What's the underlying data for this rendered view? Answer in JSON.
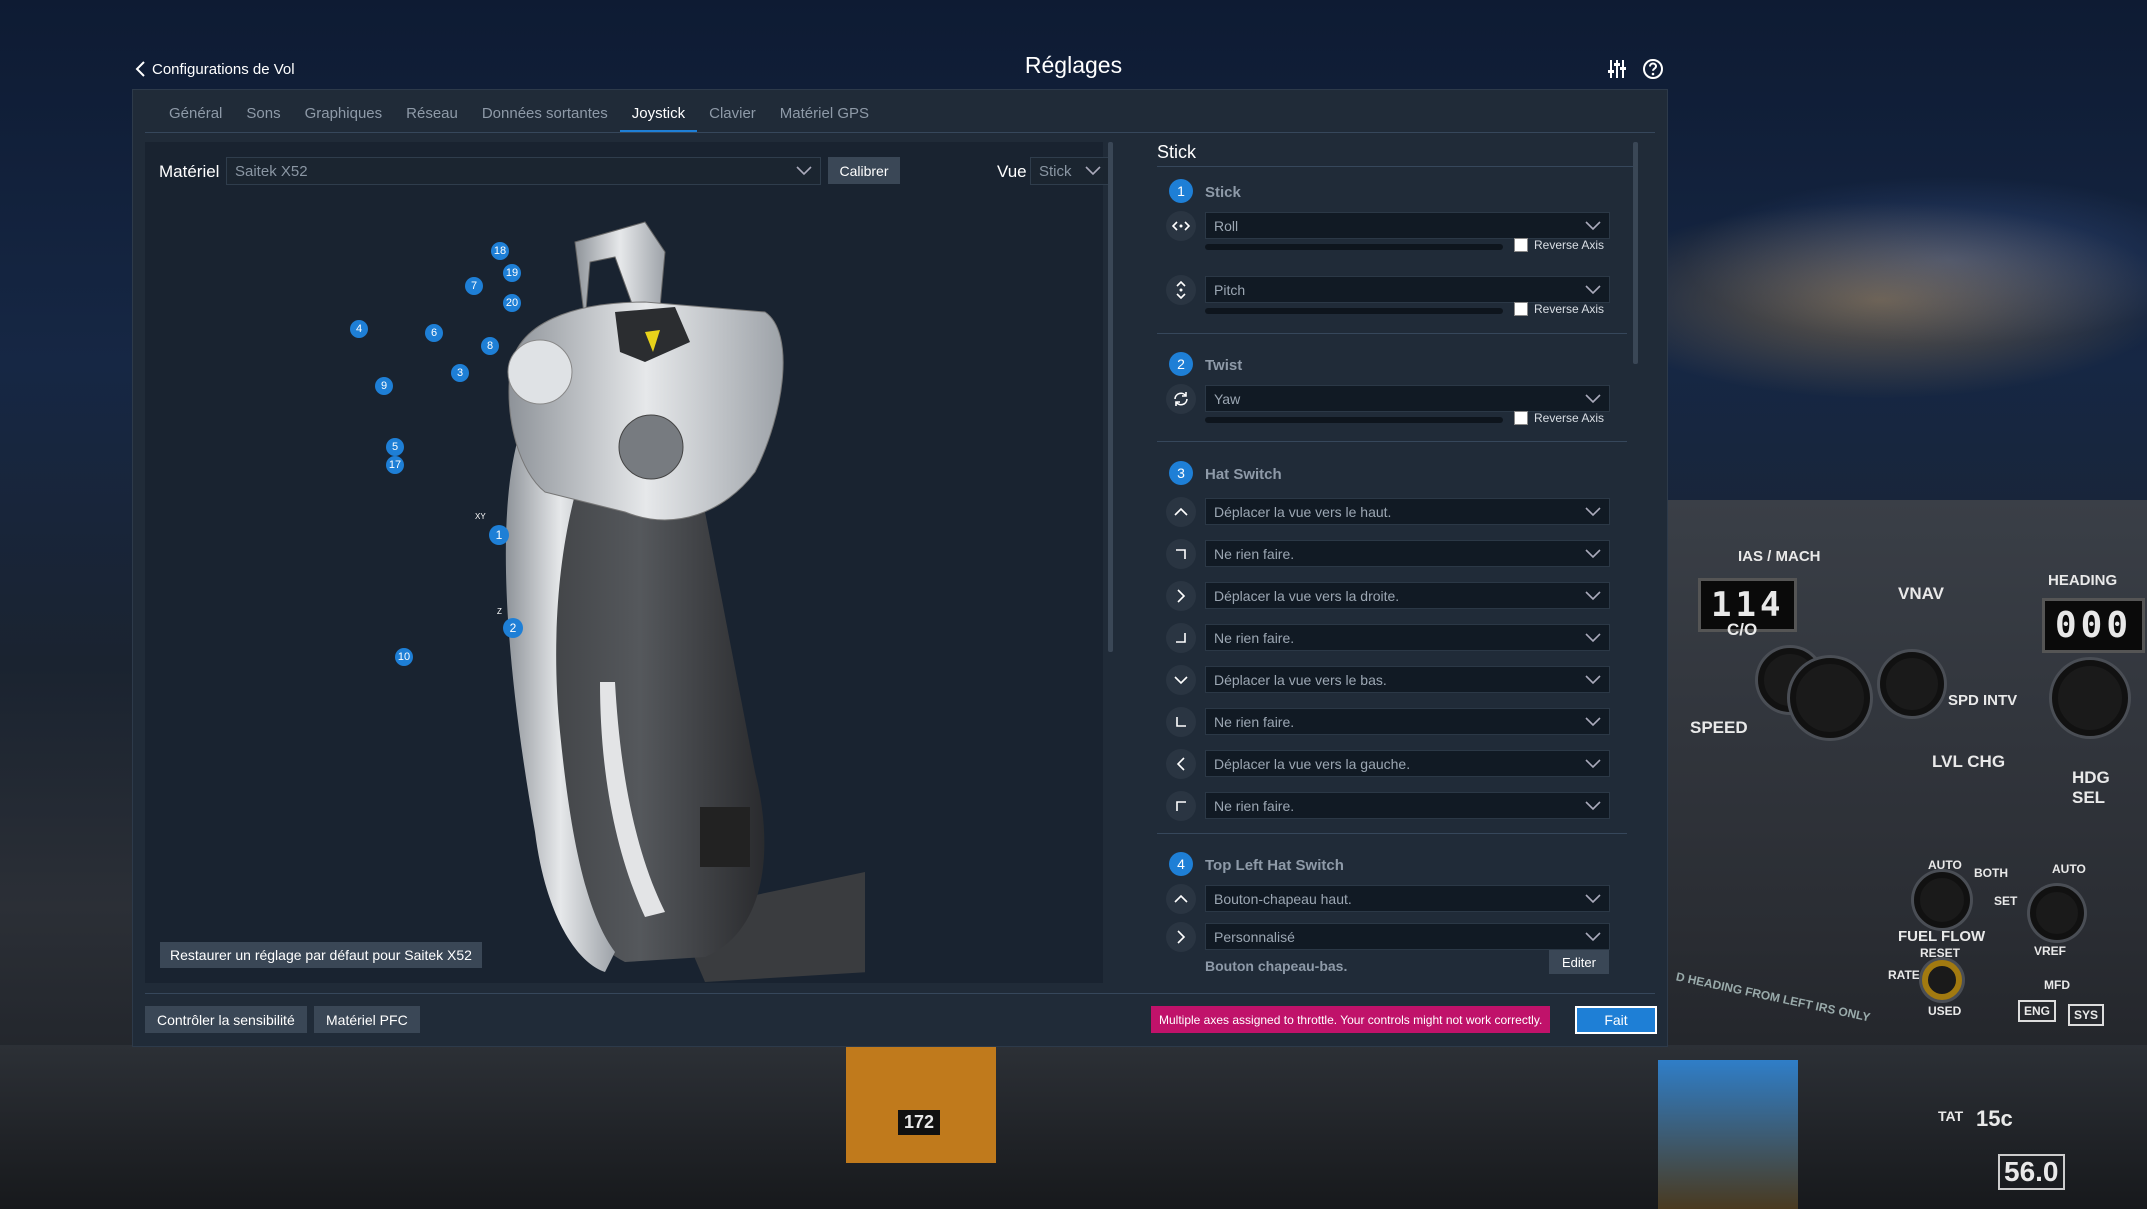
{
  "header": {
    "back_label": "Configurations de Vol",
    "title": "Réglages",
    "icons": [
      "sliders-icon",
      "help-icon"
    ]
  },
  "tabs": [
    {
      "label": "Général"
    },
    {
      "label": "Sons"
    },
    {
      "label": "Graphiques"
    },
    {
      "label": "Réseau"
    },
    {
      "label": "Données sortantes"
    },
    {
      "label": "Joystick",
      "active": true
    },
    {
      "label": "Clavier"
    },
    {
      "label": "Matériel GPS"
    }
  ],
  "left": {
    "materiel_label": "Matériel",
    "device_value": "Saitek X52",
    "calibrate_label": "Calibrer",
    "vue_label": "Vue",
    "vue_value": "Stick",
    "restore_label": "Restaurer un réglage par défaut pour Saitek X52",
    "callouts": [
      "18",
      "19",
      "20",
      "7",
      "4",
      "6",
      "8",
      "3",
      "9",
      "5",
      "17",
      "1",
      "2",
      "10"
    ],
    "callout_minor": {
      "xy": "XY",
      "z": "Z"
    }
  },
  "right": {
    "panel_title": "Stick",
    "reverse_label": "Reverse Axis",
    "sections": [
      {
        "num": "1",
        "title": "Stick",
        "rows": [
          {
            "icon": "horizontal-axis-icon",
            "value": "Roll",
            "reverse": false
          },
          {
            "icon": "vertical-axis-icon",
            "value": "Pitch",
            "reverse": false
          }
        ]
      },
      {
        "num": "2",
        "title": "Twist",
        "rows": [
          {
            "icon": "twist-axis-icon",
            "value": "Yaw",
            "reverse": false
          }
        ]
      },
      {
        "num": "3",
        "title": "Hat Switch",
        "rows": [
          {
            "icon": "up-icon",
            "value": "Déplacer la vue vers le haut."
          },
          {
            "icon": "up-right-icon",
            "value": "Ne rien faire."
          },
          {
            "icon": "right-icon",
            "value": "Déplacer la vue vers la droite."
          },
          {
            "icon": "down-right-icon",
            "value": "Ne rien faire."
          },
          {
            "icon": "down-icon",
            "value": "Déplacer la vue vers le bas."
          },
          {
            "icon": "down-left-icon",
            "value": "Ne rien faire."
          },
          {
            "icon": "left-icon",
            "value": "Déplacer la vue vers la gauche."
          },
          {
            "icon": "up-left-icon",
            "value": "Ne rien faire."
          }
        ]
      },
      {
        "num": "4",
        "title": "Top Left Hat Switch",
        "rows": [
          {
            "icon": "up-icon",
            "value": "Bouton-chapeau haut."
          },
          {
            "icon": "right-icon",
            "value": "Personnalisé"
          }
        ]
      }
    ],
    "edit_row_label": "Bouton chapeau-bas.",
    "edit_button": "Editer"
  },
  "footer": {
    "sensitivity_button": "Contrôler la sensibilité",
    "pfc_button": "Matériel PFC",
    "warning": "Multiple axes assigned to throttle. Your controls might not work correctly.",
    "done_button": "Fait"
  },
  "background": {
    "ias_label": "IAS / MACH",
    "ias_value": "114",
    "vnav_label": "VNAV",
    "heading_label": "HEADING",
    "heading_value": "000",
    "co_label": "C/O",
    "speed_label": "SPEED",
    "spd_intv_label": "SPD INTV",
    "lvl_chg_label": "LVL CHG",
    "hdg_sel_label": "HDG SEL",
    "fuel_flow_label": "FUEL FLOW",
    "reset_label": "RESET",
    "rate_label": "RATE",
    "used_label": "USED",
    "mfd_label": "MFD",
    "eng_label": "ENG",
    "sys_label": "SYS",
    "auto_label": "AUTO",
    "both_label": "BOTH",
    "set_label": "SET",
    "vref_label": "VREF",
    "tat_label": "TAT",
    "tat_value": "15c",
    "gauge_value": "56.0",
    "heading_note": "D HEADING FROM LEFT IRS ONLY",
    "tape_value": "172"
  },
  "colors": {
    "accent": "#1e7fd6",
    "warning": "#c0126a",
    "panel": "#202b38"
  }
}
